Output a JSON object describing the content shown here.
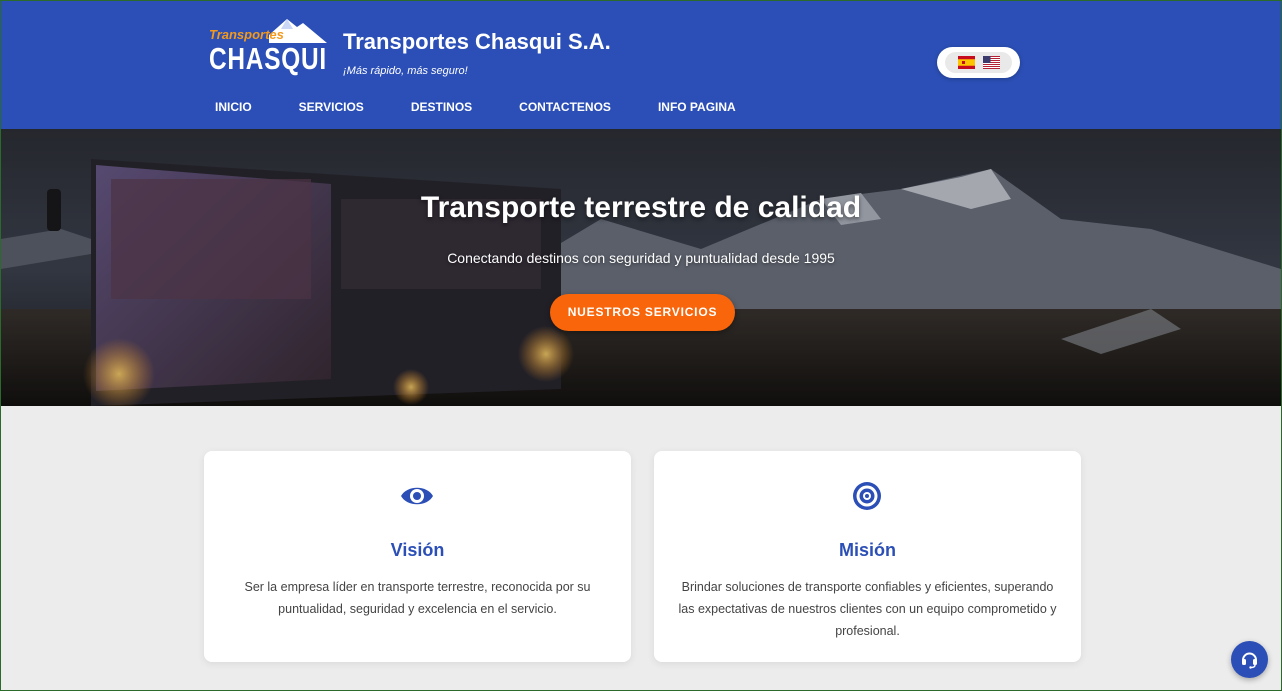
{
  "header": {
    "logo": {
      "top_text": "Transportes",
      "main_text": "CHASQUI",
      "icon": "mountain-logo-icon"
    },
    "title": "Transportes Chasqui S.A.",
    "tagline": "¡Más rápido, más seguro!",
    "languages": [
      {
        "code": "es",
        "icon": "spain-flag-icon"
      },
      {
        "code": "en",
        "icon": "usa-flag-icon"
      }
    ],
    "nav": [
      "INICIO",
      "SERVICIOS",
      "DESTINOS",
      "CONTACTENOS",
      "INFO PAGINA"
    ]
  },
  "hero": {
    "title": "Transporte terrestre de calidad",
    "subtitle": "Conectando destinos con seguridad y puntualidad desde 1995",
    "button_label": "NUESTROS SERVICIOS"
  },
  "cards": [
    {
      "icon": "eye-icon",
      "title": "Visión",
      "text": "Ser la empresa líder en transporte terrestre, reconocida por su puntualidad, seguridad y excelencia en el servicio."
    },
    {
      "icon": "target-icon",
      "title": "Misión",
      "text": "Brindar soluciones de transporte confiables y eficientes, superando las expectativas de nuestros clientes con un equipo comprometido y profesional."
    }
  ],
  "floating": {
    "icon": "headset-icon"
  },
  "colors": {
    "header_bg": "#2b4fb6",
    "accent_orange": "#f8650a",
    "page_bg": "#ececec",
    "card_title": "#2b4fb6"
  }
}
